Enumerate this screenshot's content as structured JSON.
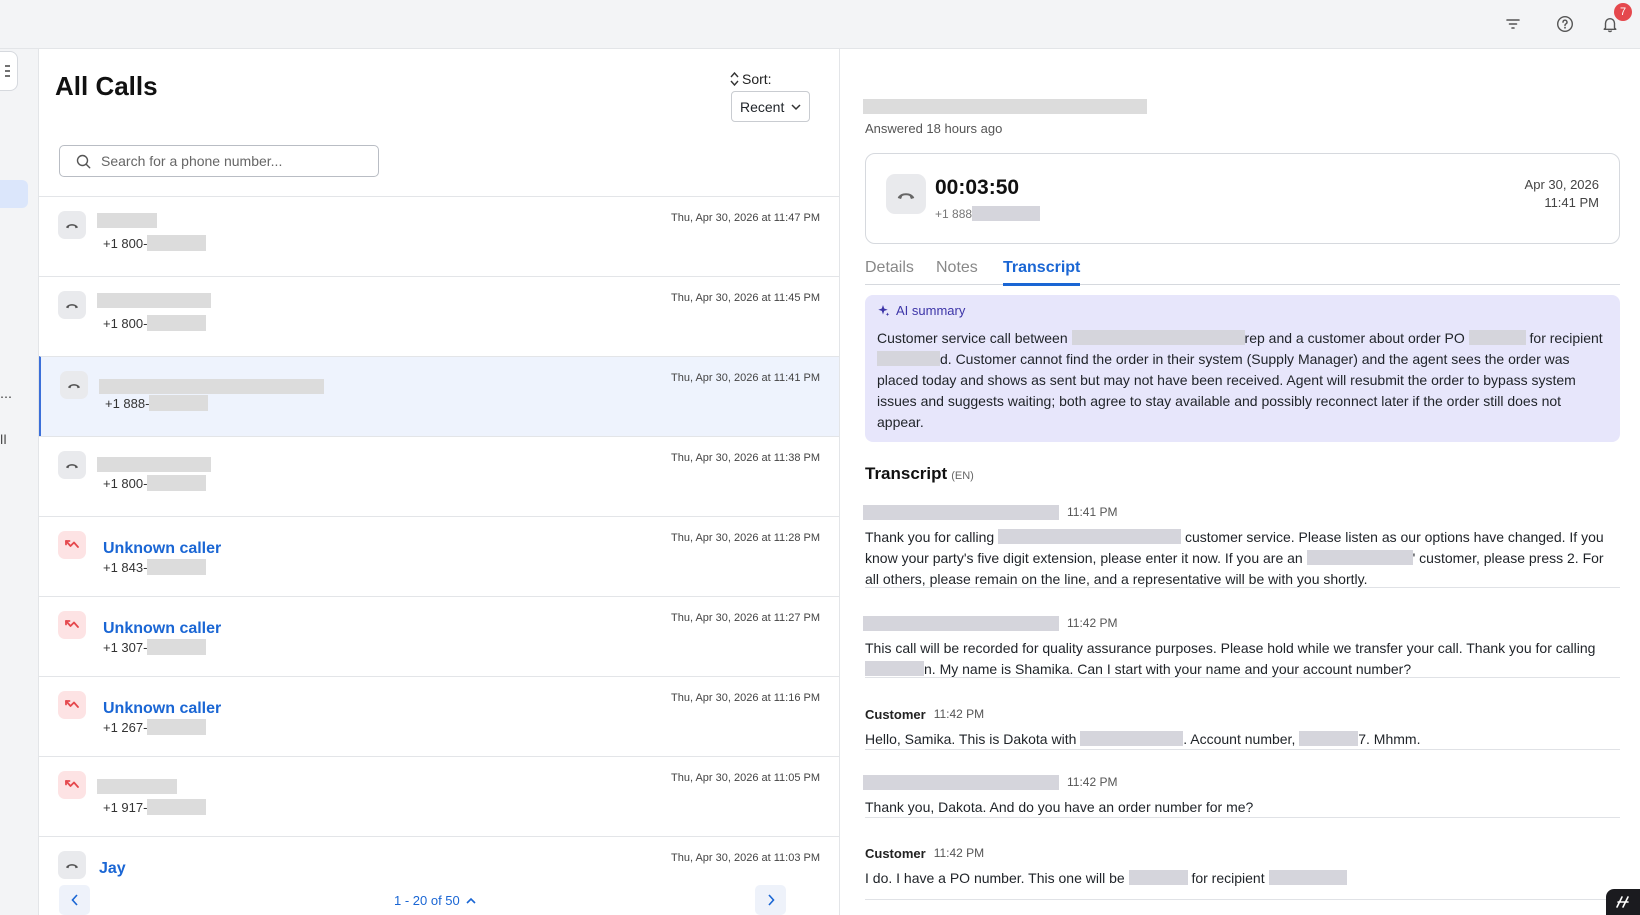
{
  "topbar": {
    "icons": [
      "filter-icon",
      "help-icon",
      "bell-icon"
    ],
    "notification_count": "7"
  },
  "sidebar": {
    "partial_glyphs": [
      "…",
      "ll"
    ]
  },
  "calls_list": {
    "title": "All Calls",
    "sort_label": "Sort:",
    "sort_value": "Recent",
    "search_placeholder": "Search for a phone number...",
    "rows": [
      {
        "name": "",
        "number": "+1 800-",
        "time": "Thu, Apr 30, 2026 at 11:47 PM",
        "status": "answered",
        "selected": false
      },
      {
        "name": "",
        "number": "+1 800-",
        "time": "Thu, Apr 30, 2026 at 11:45 PM",
        "status": "answered",
        "selected": false
      },
      {
        "name": "",
        "number": "+1 888-",
        "time": "Thu, Apr 30, 2026 at 11:41 PM",
        "status": "answered",
        "selected": true
      },
      {
        "name": "",
        "number": "+1 800-",
        "time": "Thu, Apr 30, 2026 at 11:38 PM",
        "status": "answered",
        "selected": false
      },
      {
        "name": "Unknown caller",
        "number": "+1 843-",
        "time": "Thu, Apr 30, 2026 at 11:28 PM",
        "status": "missed",
        "selected": false
      },
      {
        "name": "Unknown caller",
        "number": "+1 307-",
        "time": "Thu, Apr 30, 2026 at 11:27 PM",
        "status": "missed",
        "selected": false
      },
      {
        "name": "Unknown caller",
        "number": "+1 267-",
        "time": "Thu, Apr 30, 2026 at 11:16 PM",
        "status": "missed",
        "selected": false
      },
      {
        "name": "",
        "number": "+1 917-",
        "time": "Thu, Apr 30, 2026 at 11:05 PM",
        "status": "missed",
        "selected": false
      },
      {
        "name": "Jay",
        "number": "",
        "time": "Thu, Apr 30, 2026 at 11:03 PM",
        "status": "answered",
        "selected": false
      }
    ],
    "pagination": "1 - 20 of 50"
  },
  "call_detail": {
    "answered_text": "Answered 18 hours ago",
    "duration": "00:03:50",
    "number_prefix": "+1 888",
    "date": "Apr 30, 2026",
    "time": "11:41 PM",
    "tabs": [
      "Details",
      "Notes",
      "Transcript"
    ],
    "active_tab": "Transcript",
    "ai_summary": {
      "title": "AI summary",
      "parts": [
        "Customer service call between ",
        "rep and a customer about order PO ",
        " for recipient ",
        "d. Customer cannot find the order in their system (Supply Manager) and the agent sees the order was placed today and shows as sent but may not have been received. Agent will resubmit the order to bypass system issues and suggests waiting; both agree to stay available and possibly reconnect later if the order still does not appear."
      ]
    },
    "transcript": {
      "title": "Transcript",
      "language": "(EN)",
      "entries": [
        {
          "speaker": "",
          "time": "11:41 PM",
          "parts": [
            "Thank you for calling ",
            " customer service. Please listen as our options have changed. If you know your party's five digit extension, please enter it now. If you are an ",
            "' customer, please press 2. For all others, please remain on the line, and a representative will be with you shortly."
          ]
        },
        {
          "speaker": "",
          "time": "11:42 PM",
          "parts": [
            "This call will be recorded for quality assurance purposes. Please hold while we transfer your call. Thank you for calling ",
            "n. My name is Shamika. Can I start with your name and your account number?"
          ]
        },
        {
          "speaker": "Customer",
          "time": "11:42 PM",
          "parts": [
            "Hello, Samika. This is Dakota with ",
            ". Account number, ",
            "7. Mhmm."
          ]
        },
        {
          "speaker": "",
          "time": "11:42 PM",
          "parts": [
            "Thank you, Dakota. And do you have an order number for me?"
          ]
        },
        {
          "speaker": "Customer",
          "time": "11:42 PM",
          "parts": [
            "I do. I have a PO number. This one will be ",
            " for recipient "
          ]
        }
      ]
    }
  },
  "colors": {
    "accent": "#1a66d4",
    "ai_bg": "#e7e6fb",
    "missed_bg": "#fde3e4",
    "missed_icon": "#e5484d"
  }
}
